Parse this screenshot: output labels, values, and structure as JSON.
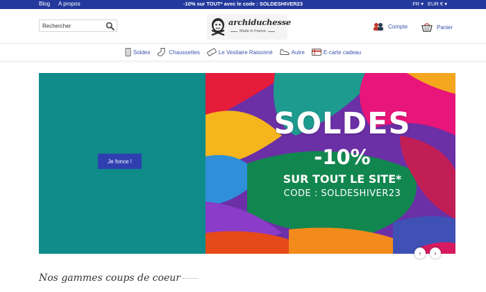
{
  "topbar": {
    "links": [
      "Blog",
      "A propos"
    ],
    "promo": "-10% sur TOUT* avec le code : SOLDESHIVER23",
    "language": "FR ▾",
    "currency": "EUR € ▾"
  },
  "header": {
    "search_placeholder": "Rechercher",
    "brand": "archiduchesse",
    "tagline": "Made in France",
    "account_label": "Compte",
    "cart_label": "Panier"
  },
  "nav": {
    "items": [
      {
        "label": "Soldes",
        "icon": "sale-tag-icon"
      },
      {
        "label": "Chaussettes",
        "icon": "sock-icon"
      },
      {
        "label": "Le Vestiaire Raisonné",
        "icon": "ticket-icon"
      },
      {
        "label": "Autre",
        "icon": "shoe-icon"
      },
      {
        "label": "E-carte cadeau",
        "icon": "gift-card-icon"
      }
    ]
  },
  "banner": {
    "cta_label": "Je fonce !",
    "headline": "SOLDES",
    "discount": "-10%",
    "subline": "SUR TOUT LE SITE*",
    "code_line": "CODE : SOLDESHIVER23",
    "left_color": "#0f8b8a",
    "cta_color": "#2f3fb0"
  },
  "carousel": {
    "prev": "‹",
    "next": "›"
  },
  "section": {
    "title": "Nos gammes coups de coeur"
  },
  "colors": {
    "topbar": "#24399c",
    "link": "#3b52a8"
  }
}
